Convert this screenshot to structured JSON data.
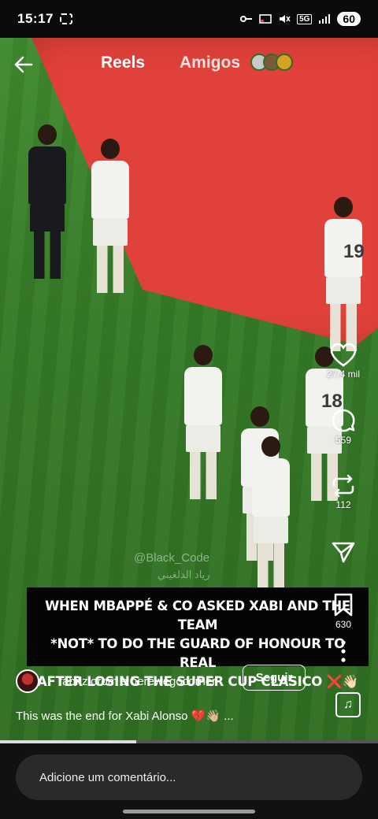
{
  "status": {
    "time": "15:17",
    "network": "5G",
    "battery": "60"
  },
  "nav": {
    "title": "Reels",
    "friends_tab": "Amigos"
  },
  "video": {
    "watermark": "@Black_Code",
    "watermark_ar": "رياد الدلغيني",
    "jersey_a": "19",
    "jersey_b": "18",
    "caption_line1": "WHEN MBAPPÉ & CO ASKED XABI AND THE TEAM",
    "caption_line2": "*NOT* TO DO THE GUARD OF HONOUR TO REAL",
    "caption_line3": "AFTER LOSING THE SUPER CUP CLASICO",
    "caption_emoji": "❌👋🏻"
  },
  "rail": {
    "likes": "27,4 mil",
    "comments": "559",
    "reposts": "112",
    "saves": "630"
  },
  "post": {
    "author": "fabriziorom e herewegocorner",
    "follow_label": "Seguir",
    "description": "This was the end for Xabi Alonso 💔👋🏼 ..."
  },
  "playback": {
    "progress": 0.36
  },
  "comment": {
    "placeholder": "Adicione um comentário..."
  },
  "colors": {
    "carpet": "#e0413a",
    "grass": "#357a27"
  }
}
